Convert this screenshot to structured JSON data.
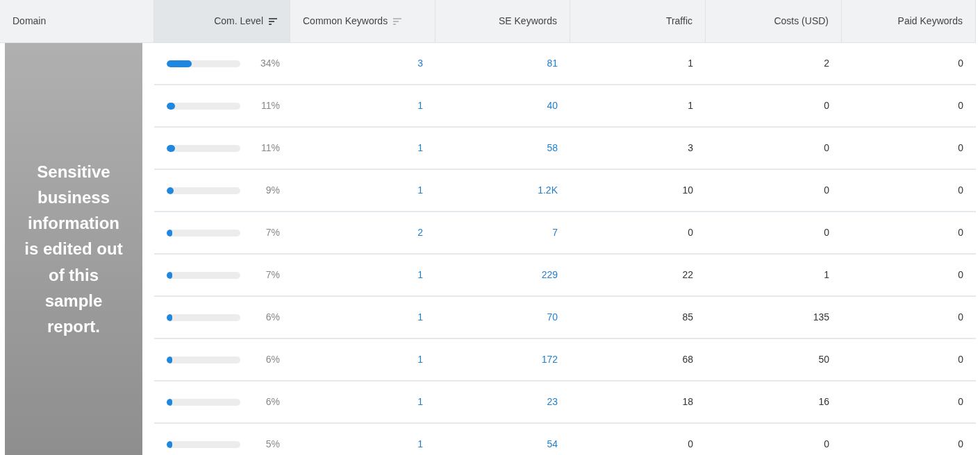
{
  "table": {
    "columns": [
      {
        "label": "Domain",
        "sortable": false,
        "sorted": false
      },
      {
        "label": "Com. Level",
        "sortable": true,
        "sorted": true
      },
      {
        "label": "Common Keywords",
        "sortable": true,
        "sorted": false
      },
      {
        "label": "SE Keywords",
        "sortable": false,
        "sorted": false
      },
      {
        "label": "Traffic",
        "sortable": false,
        "sorted": false
      },
      {
        "label": "Costs (USD)",
        "sortable": false,
        "sorted": false
      },
      {
        "label": "Paid Keywords",
        "sortable": false,
        "sorted": false
      }
    ],
    "redaction_note": "Sensitive business information is edited out of this sample report.",
    "rows": [
      {
        "level": 0.34,
        "percent": "34%",
        "common_keywords": "3",
        "se_keywords": "81",
        "traffic": "1",
        "costs": "2",
        "paid_keywords": "0"
      },
      {
        "level": 0.11,
        "percent": "11%",
        "common_keywords": "1",
        "se_keywords": "40",
        "traffic": "1",
        "costs": "0",
        "paid_keywords": "0"
      },
      {
        "level": 0.11,
        "percent": "11%",
        "common_keywords": "1",
        "se_keywords": "58",
        "traffic": "3",
        "costs": "0",
        "paid_keywords": "0"
      },
      {
        "level": 0.09,
        "percent": "9%",
        "common_keywords": "1",
        "se_keywords": "1.2K",
        "traffic": "10",
        "costs": "0",
        "paid_keywords": "0"
      },
      {
        "level": 0.07,
        "percent": "7%",
        "common_keywords": "2",
        "se_keywords": "7",
        "traffic": "0",
        "costs": "0",
        "paid_keywords": "0"
      },
      {
        "level": 0.07,
        "percent": "7%",
        "common_keywords": "1",
        "se_keywords": "229",
        "traffic": "22",
        "costs": "1",
        "paid_keywords": "0"
      },
      {
        "level": 0.06,
        "percent": "6%",
        "common_keywords": "1",
        "se_keywords": "70",
        "traffic": "85",
        "costs": "135",
        "paid_keywords": "0"
      },
      {
        "level": 0.06,
        "percent": "6%",
        "common_keywords": "1",
        "se_keywords": "172",
        "traffic": "68",
        "costs": "50",
        "paid_keywords": "0"
      },
      {
        "level": 0.06,
        "percent": "6%",
        "common_keywords": "1",
        "se_keywords": "23",
        "traffic": "18",
        "costs": "16",
        "paid_keywords": "0"
      },
      {
        "level": 0.05,
        "percent": "5%",
        "common_keywords": "1",
        "se_keywords": "54",
        "traffic": "0",
        "costs": "0",
        "paid_keywords": "0"
      }
    ]
  }
}
